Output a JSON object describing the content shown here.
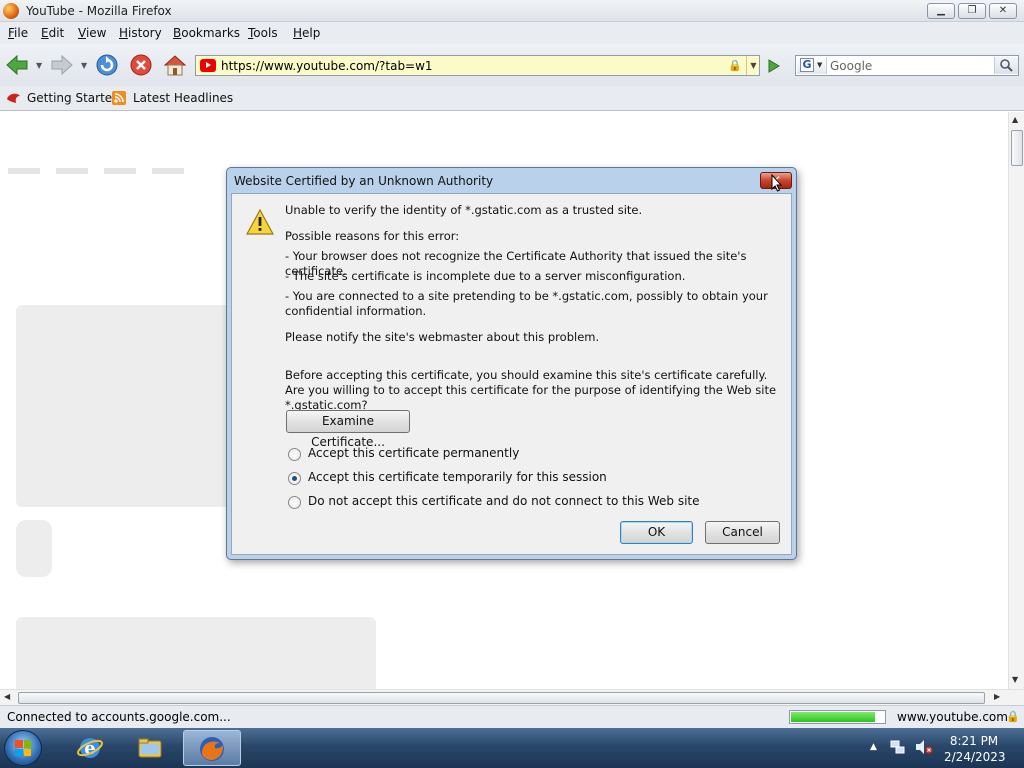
{
  "window": {
    "title": "YouTube - Mozilla Firefox",
    "controls": {
      "minimize": "▁",
      "maximize": "❐",
      "close": "✕"
    }
  },
  "menubar": {
    "items": [
      "File",
      "Edit",
      "View",
      "History",
      "Bookmarks",
      "Tools",
      "Help"
    ]
  },
  "navbar": {
    "url": "https://www.youtube.com/?tab=w1",
    "search_placeholder": "Google",
    "search_engine_letter": "G"
  },
  "bookmarks": {
    "items": [
      "Getting Started",
      "Latest Headlines"
    ]
  },
  "dialog": {
    "title": "Website Certified by an Unknown Authority",
    "headline": "Unable to verify the identity of *.gstatic.com as a trusted site.",
    "reasons_heading": "Possible reasons for this error:",
    "reasons": [
      "- Your browser does not recognize the Certificate Authority that issued the site's certificate.",
      "- The site's certificate is incomplete due to a server misconfiguration.",
      "- You are connected to a site pretending to be *.gstatic.com, possibly to obtain your confidential information."
    ],
    "notify": "Please notify the site's webmaster about this problem.",
    "before_accepting": "Before accepting this certificate, you should examine this site's certificate carefully. Are you willing to to accept this certificate for the purpose of identifying the Web site *.gstatic.com?",
    "examine_button": "Examine Certificate...",
    "options": [
      {
        "label": "Accept this certificate permanently",
        "selected": false
      },
      {
        "label": "Accept this certificate temporarily for this session",
        "selected": true
      },
      {
        "label": "Do not accept this certificate and do not connect to this Web site",
        "selected": false
      }
    ],
    "ok_button": "OK",
    "cancel_button": "Cancel"
  },
  "statusbar": {
    "status_text": "Connected to accounts.google.com...",
    "progress_fraction": 0.9,
    "domain": "www.youtube.com"
  },
  "taskbar": {
    "clock_time": "8:21 PM",
    "clock_date": "2/24/2023"
  },
  "colors": {
    "dialog_frame": "#b9d1ea",
    "progress_green": "#2cc41f",
    "taskbar_blue": "#294769",
    "urlbar_secure": "#fbfbc8"
  },
  "icons": [
    "firefox-icon",
    "back-arrow-icon",
    "forward-arrow-icon",
    "reload-icon",
    "stop-icon",
    "home-icon",
    "youtube-favicon",
    "padlock-icon",
    "go-arrow-icon",
    "magnifier-icon",
    "warning-icon",
    "windows-start-icon",
    "internet-explorer-icon",
    "folder-icon",
    "network-icon",
    "volume-muted-icon"
  ]
}
